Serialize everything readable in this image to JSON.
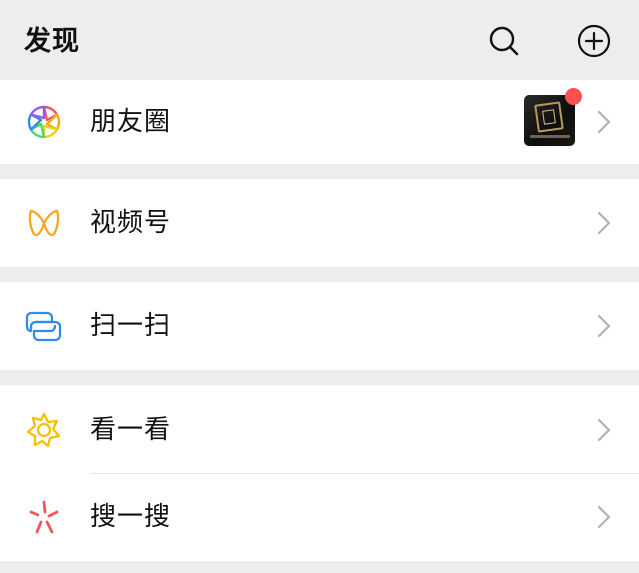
{
  "header": {
    "title": "发现",
    "search_icon": "search-icon",
    "add_icon": "plus-circle-icon"
  },
  "menu": {
    "moments": {
      "label": "朋友圈",
      "icon": "moments-aperture-icon",
      "has_unread_dot": true,
      "dot_color": "#fa5151"
    },
    "channels": {
      "label": "视频号",
      "icon": "channels-icon",
      "icon_color": "#f5a623"
    },
    "scan": {
      "label": "扫一扫",
      "icon": "scan-icon",
      "icon_color": "#2d8cf0"
    },
    "top_stories": {
      "label": "看一看",
      "icon": "top-stories-icon",
      "icon_color": "#f5c000"
    },
    "search": {
      "label": "搜一搜",
      "icon": "search-sparkle-icon",
      "icon_color": "#f25757"
    }
  },
  "colors": {
    "background": "#ededed",
    "card": "#ffffff",
    "text": "#111111",
    "chevron": "#b2b2b2"
  }
}
